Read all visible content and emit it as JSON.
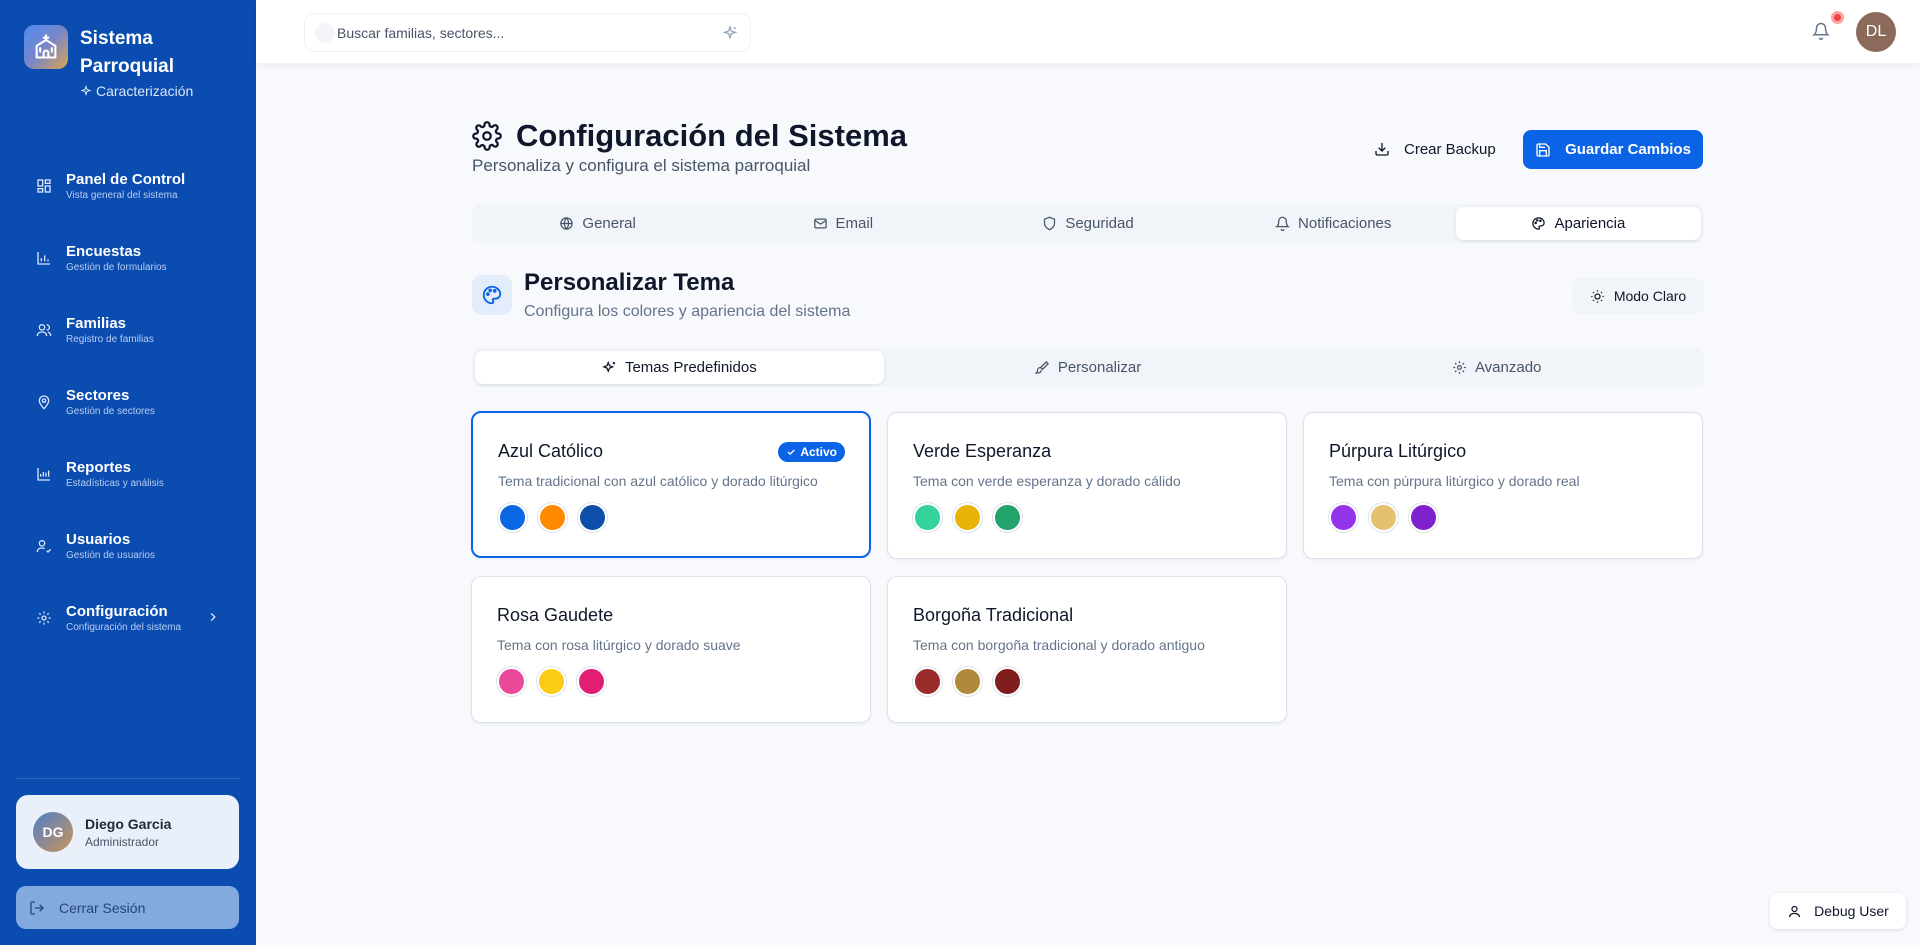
{
  "app": {
    "title": "Sistema Parroquial",
    "subtitle": "Caracterización"
  },
  "sidebar": {
    "items": [
      {
        "label": "Panel de Control",
        "sub": "Vista general del sistema"
      },
      {
        "label": "Encuestas",
        "sub": "Gestión de formularios"
      },
      {
        "label": "Familias",
        "sub": "Registro de familias"
      },
      {
        "label": "Sectores",
        "sub": "Gestión de sectores"
      },
      {
        "label": "Reportes",
        "sub": "Estadísticas y análisis"
      },
      {
        "label": "Usuarios",
        "sub": "Gestión de usuarios"
      },
      {
        "label": "Configuración",
        "sub": "Configuración del sistema"
      }
    ],
    "user": {
      "initials": "DG",
      "name": "Diego Garcia",
      "role": "Administrador"
    },
    "logout_label": "Cerrar Sesión"
  },
  "topbar": {
    "search_placeholder": "Buscar familias, sectores...",
    "avatar_initials": "DL"
  },
  "page": {
    "title": "Configuración del Sistema",
    "subtitle": "Personaliza y configura el sistema parroquial",
    "backup_label": "Crear Backup",
    "save_label": "Guardar Cambios"
  },
  "tabs": [
    {
      "label": "General"
    },
    {
      "label": "Email"
    },
    {
      "label": "Seguridad"
    },
    {
      "label": "Notificaciones"
    },
    {
      "label": "Apariencia",
      "active": true
    }
  ],
  "theme_section": {
    "title": "Personalizar Tema",
    "subtitle": "Configura los colores y apariencia del sistema",
    "mode_label": "Modo Claro",
    "subtabs": [
      {
        "label": "Temas Predefinidos",
        "active": true
      },
      {
        "label": "Personalizar"
      },
      {
        "label": "Avanzado"
      }
    ],
    "active_badge": "Activo",
    "themes": [
      {
        "name": "Azul Católico",
        "desc": "Tema tradicional con azul católico y dorado litúrgico",
        "colors": [
          "#0b66e4",
          "#ff8a00",
          "#0d4fa8"
        ],
        "active": true
      },
      {
        "name": "Verde Esperanza",
        "desc": "Tema con verde esperanza y dorado cálido",
        "colors": [
          "#34d399",
          "#eab308",
          "#22a36b"
        ]
      },
      {
        "name": "Púrpura Litúrgico",
        "desc": "Tema con púrpura litúrgico y dorado real",
        "colors": [
          "#9333ea",
          "#e3c16f",
          "#7e22ce"
        ]
      },
      {
        "name": "Rosa Gaudete",
        "desc": "Tema con rosa litúrgico y dorado suave",
        "colors": [
          "#ec4899",
          "#facc15",
          "#e11d74"
        ]
      },
      {
        "name": "Borgoña Tradicional",
        "desc": "Tema con borgoña tradicional y dorado antiguo",
        "colors": [
          "#9b2c2c",
          "#b08a3a",
          "#7f1d1d"
        ]
      }
    ]
  },
  "debug_label": "Debug User"
}
